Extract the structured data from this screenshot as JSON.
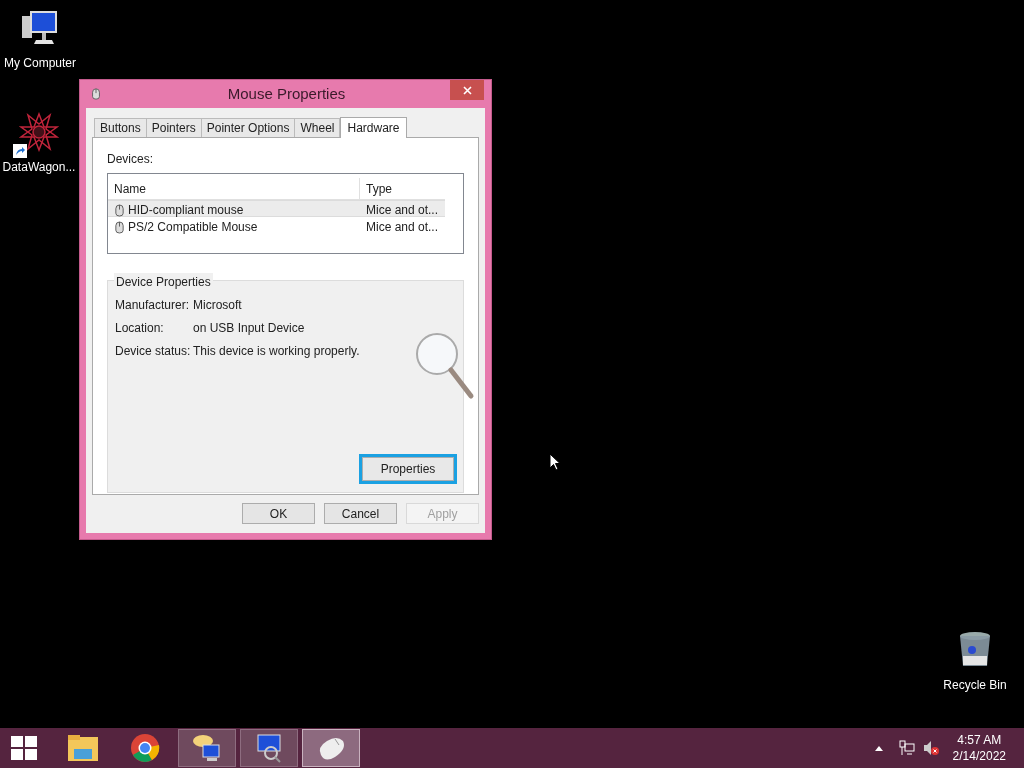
{
  "desktop": {
    "icons": [
      {
        "kind": "computer",
        "label": "My Computer"
      },
      {
        "kind": "app",
        "label": "DataWagon..."
      },
      {
        "kind": "recycle-bin",
        "label": "Recycle Bin"
      }
    ]
  },
  "dialog": {
    "title": "Mouse Properties",
    "tabs": [
      {
        "label": "Buttons",
        "selected": false
      },
      {
        "label": "Pointers",
        "selected": false
      },
      {
        "label": "Pointer Options",
        "selected": false
      },
      {
        "label": "Wheel",
        "selected": false
      },
      {
        "label": "Hardware",
        "selected": true
      }
    ],
    "devices_label": "Devices:",
    "columns": [
      "Name",
      "Type"
    ],
    "rows": [
      {
        "name": "HID-compliant mouse",
        "type": "Mice and ot...",
        "selected": true
      },
      {
        "name": "PS/2 Compatible Mouse",
        "type": "Mice and ot...",
        "selected": false
      }
    ],
    "group_title": "Device Properties",
    "properties": [
      {
        "label": "Manufacturer:",
        "value": "Microsoft"
      },
      {
        "label": "Location:",
        "value": "on USB Input Device"
      },
      {
        "label": "Device status:",
        "value": "This device is working properly."
      }
    ],
    "properties_button": {
      "label": "Properties",
      "focused": true
    },
    "buttons": [
      {
        "label": "OK",
        "disabled": false
      },
      {
        "label": "Cancel",
        "disabled": false
      },
      {
        "label": "Apply",
        "disabled": true
      }
    ]
  },
  "taskbar": {
    "apps": [
      {
        "kind": "folder",
        "running": false,
        "selected": false
      },
      {
        "kind": "browser",
        "running": false,
        "selected": false
      },
      {
        "kind": "chat",
        "running": true,
        "selected": false
      },
      {
        "kind": "search-computer",
        "running": true,
        "selected": false
      },
      {
        "kind": "mouse",
        "running": true,
        "selected": true
      }
    ],
    "time": "4:57 AM",
    "date": "2/14/2022"
  }
}
